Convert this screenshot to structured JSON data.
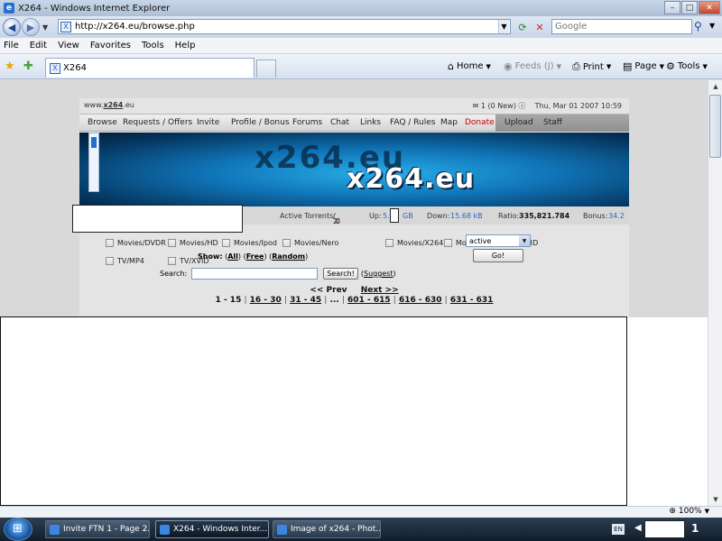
{
  "window": {
    "title": "X264 - Windows Internet Explorer",
    "controls": {
      "minimize": "–",
      "maximize": "□",
      "close": "✕"
    }
  },
  "address": {
    "url": "http://x264.eu/browse.php",
    "search_placeholder": "Google"
  },
  "menu": [
    "File",
    "Edit",
    "View",
    "Favorites",
    "Tools",
    "Help"
  ],
  "tabs": {
    "active_label": "X264"
  },
  "toolbar": {
    "home": "Home",
    "feeds": "Feeds (J)",
    "print": "Print",
    "page": "Page",
    "tools": "Tools"
  },
  "site": {
    "domain_prefix": "www.",
    "domain_name": "x264",
    "domain_suffix": ".eu",
    "messages": "1 (0 New)",
    "date": "Thu, Mar 01 2007 10:59",
    "nav": [
      "Browse",
      "Requests / Offers",
      "Invite",
      "Profile / Bonus",
      "Forums",
      "Chat",
      "Links",
      "FAQ / Rules",
      "Map",
      "Donate",
      "Upload",
      "Staff"
    ],
    "banner_text": "x264.eu",
    "stats": {
      "active_label": "Active Torrents:",
      "seeding": "2",
      "leeching": "0",
      "up_label": "Up:",
      "up_value_start": "5.",
      "up_value_unit": "GB",
      "down_label": "Down:",
      "down_value": "15.68 kB",
      "ratio_label": "Ratio:",
      "ratio_value": "335,821.784",
      "bonus_label": "Bonus:",
      "bonus_value": "34.2"
    },
    "categories_row1": [
      "Movies/DVDR",
      "Movies/HD",
      "Movies/Ipod",
      "Movies/Nero",
      "Movies/X264",
      "Movies/XVID",
      "TV/HD"
    ],
    "categories_row2": [
      "TV/MP4",
      "TV/XVID"
    ],
    "status_select": "active",
    "go_label": "Go!",
    "show": {
      "label": "Show:",
      "all": "All",
      "free": "Free",
      "random": "Random"
    },
    "search": {
      "label": "Search:",
      "button": "Search!",
      "suggest": "Suggest"
    },
    "pager": {
      "prev": "<< Prev",
      "next": "Next >>",
      "current": "1 - 15",
      "pages": [
        "16 - 30",
        "31 - 45",
        "...",
        "601 - 615",
        "616 - 630",
        "631 - 631"
      ]
    }
  },
  "statusbar": {
    "zoom": "100%"
  },
  "taskbar": {
    "items": [
      "Invite FTN 1 - Page 2...",
      "X264 - Windows Inter...",
      "Image of x264 - Phot..."
    ],
    "lang": "EN",
    "clock": "1"
  }
}
